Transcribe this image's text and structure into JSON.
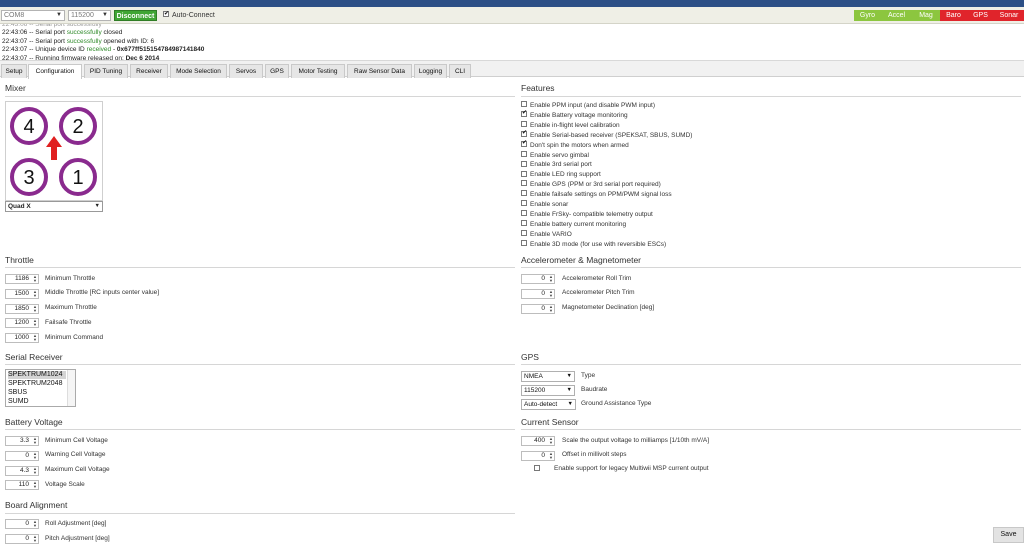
{
  "topbar": {
    "port": "COM8",
    "baud": "115200",
    "connect_label": "Disconnect",
    "autoconnect_label": "Auto-Connect",
    "sensors": [
      {
        "label": "Gyro",
        "color": "#8cc63f"
      },
      {
        "label": "Accel",
        "color": "#8cc63f"
      },
      {
        "label": "Mag",
        "color": "#8cc63f"
      },
      {
        "label": "Baro",
        "color": "#e0242b"
      },
      {
        "label": "GPS",
        "color": "#e0242b"
      },
      {
        "label": "Sonar",
        "color": "#e0242b"
      }
    ]
  },
  "log": {
    "lines": [
      {
        "time": "22:43:06",
        "pre": " -- Serial port ",
        "hl": "successfully",
        "post": " closed",
        "bold": ""
      },
      {
        "time": "22:43:07",
        "pre": " -- Serial port ",
        "hl": "successfully",
        "post": " opened with ID: 6",
        "bold": ""
      },
      {
        "time": "22:43:07",
        "pre": " -- Unique device ID ",
        "hl": "received",
        "post": " - ",
        "bold": "0x677ff515154784987141840"
      },
      {
        "time": "22:43:07",
        "pre": " -- Running firmware released on: ",
        "hl": "",
        "post": "",
        "bold": "Dec 6 2014"
      }
    ]
  },
  "tabs": [
    "Setup",
    "Configuration",
    "PID Tuning",
    "Receiver",
    "Mode Selection",
    "Servos",
    "GPS",
    "Motor Testing",
    "Raw Sensor Data",
    "Logging",
    "CLI"
  ],
  "mixer": {
    "title": "Mixer",
    "selected": "Quad X",
    "motors": [
      "4",
      "2",
      "3",
      "1"
    ],
    "accent": "#8a2a8e",
    "arrow_color": "#e02020"
  },
  "features": {
    "title": "Features",
    "items": [
      {
        "label": "Enable PPM input (and disable PWM input)",
        "checked": false
      },
      {
        "label": "Enable Battery voltage monitoring",
        "checked": true
      },
      {
        "label": "Enable in-flight level calibration",
        "checked": false
      },
      {
        "label": "Enable Serial-based receiver (SPEKSAT, SBUS, SUMD)",
        "checked": true
      },
      {
        "label": "Don't spin the motors when armed",
        "checked": true
      },
      {
        "label": "Enable servo gimbal",
        "checked": false
      },
      {
        "label": "Enable 3rd serial port",
        "checked": false
      },
      {
        "label": "Enable LED ring support",
        "checked": false
      },
      {
        "label": "Enable GPS (PPM or 3rd serial port required)",
        "checked": false
      },
      {
        "label": "Enable failsafe settings on PPM/PWM signal loss",
        "checked": false
      },
      {
        "label": "Enable sonar",
        "checked": false
      },
      {
        "label": "Enable FrSky- compatible telemetry output",
        "checked": false
      },
      {
        "label": "Enable battery current monitoring",
        "checked": false
      },
      {
        "label": "Enable VARIO",
        "checked": false
      },
      {
        "label": "Enable 3D mode (for use with reversible ESCs)",
        "checked": false
      }
    ]
  },
  "throttle": {
    "title": "Throttle",
    "rows": [
      {
        "value": "1186",
        "label": "Minimum Throttle"
      },
      {
        "value": "1500",
        "label": "Middle Throttle [RC inputs center value]"
      },
      {
        "value": "1850",
        "label": "Maximum Throttle"
      },
      {
        "value": "1200",
        "label": "Failsafe Throttle"
      },
      {
        "value": "1000",
        "label": "Minimum Command"
      }
    ]
  },
  "accel": {
    "title": "Accelerometer & Magnetometer",
    "rows": [
      {
        "value": "0",
        "label": "Accelerometer Roll Trim"
      },
      {
        "value": "0",
        "label": "Accelerometer Pitch Trim"
      },
      {
        "value": "0",
        "label": "Magnetometer Declination [deg]"
      }
    ]
  },
  "serial_rx": {
    "title": "Serial Receiver",
    "options": [
      "SPEKTRUM1024",
      "SPEKTRUM2048",
      "SBUS",
      "SUMD"
    ],
    "selected_index": 0
  },
  "gps": {
    "title": "GPS",
    "rows": [
      {
        "value": "NMEA",
        "label": "Type"
      },
      {
        "value": "115200",
        "label": "Baudrate"
      },
      {
        "value": "Auto-detect",
        "label": "Ground Assistance Type"
      }
    ]
  },
  "battery": {
    "title": "Battery Voltage",
    "rows": [
      {
        "value": "3.3",
        "label": "Minimum Cell Voltage"
      },
      {
        "value": "0",
        "label": "Warning Cell Voltage"
      },
      {
        "value": "4.3",
        "label": "Maximum Cell Voltage"
      },
      {
        "value": "110",
        "label": "Voltage Scale"
      }
    ]
  },
  "current": {
    "title": "Current Sensor",
    "rows": [
      {
        "value": "400",
        "label": "Scale the output voltage to milliamps [1/10th mV/A]"
      },
      {
        "value": "0",
        "label": "Offset in millivolt steps"
      }
    ],
    "legacy_label": "Enable support for legacy Multiwii MSP current output",
    "legacy_checked": false
  },
  "board": {
    "title": "Board Alignment",
    "rows": [
      {
        "value": "0",
        "label": "Roll Adjustment [deg]"
      },
      {
        "value": "0",
        "label": "Pitch Adjustment [deg]"
      }
    ]
  },
  "save_label": "Save"
}
